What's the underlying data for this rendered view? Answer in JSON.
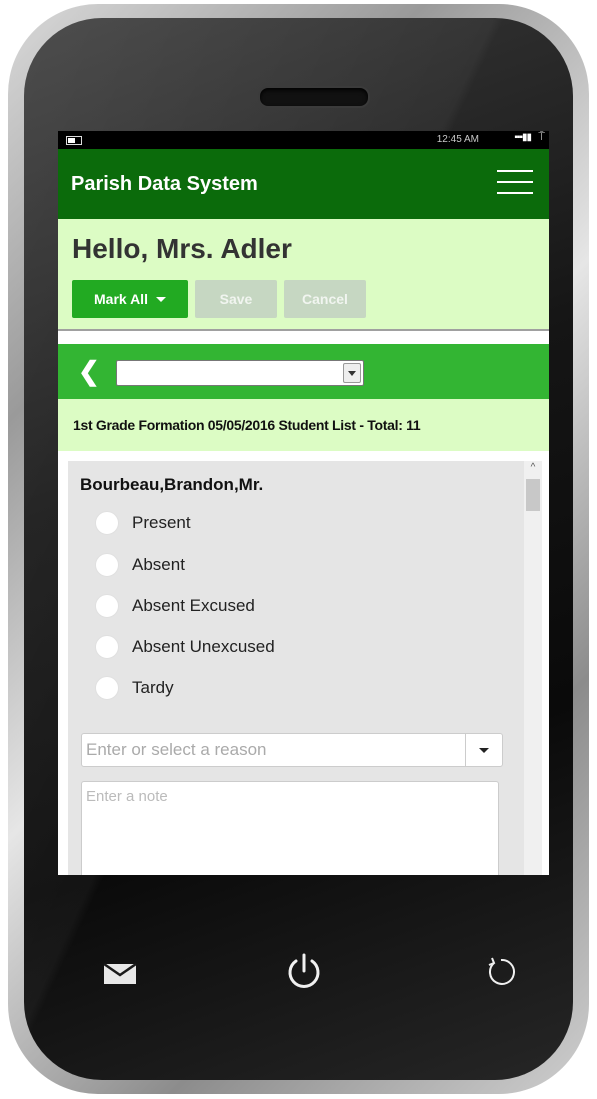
{
  "status_bar": {
    "time": "12:45 AM",
    "signal": "▪▪▪▮▮",
    "network": "⍑"
  },
  "header": {
    "brand": "Parish Data System"
  },
  "greeting": {
    "text": "Hello, Mrs. Adler"
  },
  "toolbar": {
    "mark_all_label": "Mark All",
    "save_label": "Save",
    "cancel_label": "Cancel"
  },
  "filter": {
    "back_glyph": "❮",
    "selected_value": ""
  },
  "class_info": {
    "text": "1st Grade Formation 05/05/2016 Student List - Total: 11"
  },
  "student": {
    "name": "Bourbeau,Brandon,Mr.",
    "options": [
      "Present",
      "Absent",
      "Absent Excused",
      "Absent Unexcused",
      "Tardy"
    ],
    "reason_placeholder": "Enter or select a reason",
    "note_placeholder": "Enter a note"
  },
  "scrollbar": {
    "up_glyph": "^"
  },
  "icons": {
    "menu": "hamburger-icon",
    "mail": "mail-icon",
    "power": "power-icon",
    "refresh": "refresh-icon"
  },
  "colors": {
    "navbar": "#0b6b0b",
    "accent_green": "#22aa22",
    "filter_bar": "#33b533",
    "light_green": "#dcfcc4",
    "disabled_button": "#c6d7c2"
  }
}
